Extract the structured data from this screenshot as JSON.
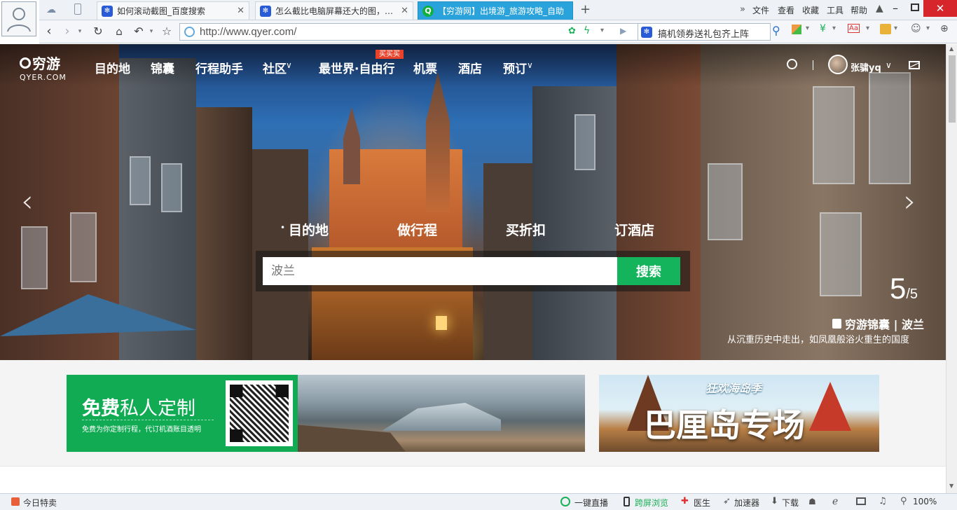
{
  "browser": {
    "tabs": [
      {
        "title": "如何滚动截图_百度搜索",
        "active": false
      },
      {
        "title": "怎么截比电脑屏幕还大的图，怎么",
        "active": false
      },
      {
        "title": "【穷游网】出境游_旅游攻略_自助",
        "active": true
      }
    ],
    "new_tab": "+",
    "menu": [
      "文件",
      "查看",
      "收藏",
      "工具",
      "帮助"
    ],
    "url": "http://www.qyer.com/",
    "search_text": "搞机领券送礼包齐上阵"
  },
  "site": {
    "logo_cn": "穷游",
    "logo_en": "QYER.COM",
    "nav": [
      "目的地",
      "锦囊",
      "行程助手",
      "社区",
      "最世界·自由行",
      "机票",
      "酒店",
      "预订"
    ],
    "hot_badge": "买买买",
    "user_name": "张骕yq"
  },
  "hero": {
    "tabs": [
      "目的地",
      "做行程",
      "买折扣",
      "订酒店"
    ],
    "active_tab": "目的地",
    "search_placeholder": "波兰",
    "search_button": "搜索",
    "slide_current": "5",
    "slide_total": "/5",
    "caption_title": "穷游锦囊 | 波兰",
    "caption_sub": "从沉重历史中走出，如凤凰般浴火重生的国度"
  },
  "banners": {
    "left_title_bold": "免费",
    "left_title_rest": "私人定制",
    "left_sub": "免费为你定制行程，代订机酒账目透明",
    "right_tag": "狂欢海岛季",
    "right_title": "巴厘岛专场"
  },
  "status": {
    "left": "今日特卖",
    "items": [
      "一键直播",
      "跨屏浏览",
      "医生",
      "加速器",
      "下载"
    ],
    "zoom": "100%"
  },
  "colors": {
    "accent_green": "#14b45c",
    "tab_active": "#2aa3dc",
    "hot_badge": "#e8422b"
  }
}
